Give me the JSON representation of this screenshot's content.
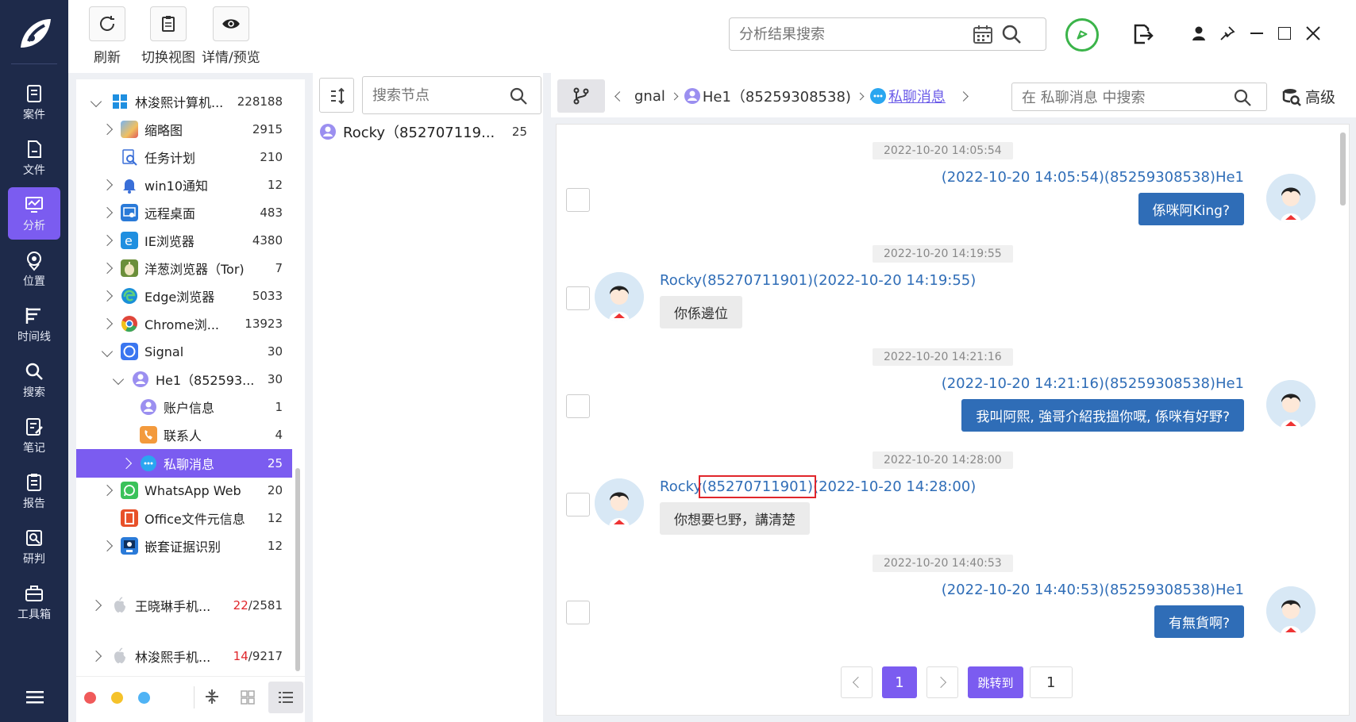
{
  "nav": {
    "items": [
      {
        "label": "案件",
        "icon": "case-icon"
      },
      {
        "label": "文件",
        "icon": "file-icon"
      },
      {
        "label": "分析",
        "icon": "analysis-icon"
      },
      {
        "label": "位置",
        "icon": "location-icon"
      },
      {
        "label": "时间线",
        "icon": "timeline-icon"
      },
      {
        "label": "搜索",
        "icon": "search-icon"
      },
      {
        "label": "笔记",
        "icon": "note-icon"
      },
      {
        "label": "报告",
        "icon": "report-icon"
      },
      {
        "label": "研判",
        "icon": "judge-icon"
      },
      {
        "label": "工具箱",
        "icon": "toolbox-icon"
      }
    ]
  },
  "toolbar": {
    "refresh": "刷新",
    "switch_view": "切换视图",
    "details": "详情/预览",
    "search_placeholder": "分析结果搜索"
  },
  "tree": {
    "root": {
      "label": "林浚熙计算机...",
      "count": "228188"
    },
    "items": [
      {
        "label": "缩略图",
        "count": "2915"
      },
      {
        "label": "任务计划",
        "count": "210"
      },
      {
        "label": "win10通知",
        "count": "12"
      },
      {
        "label": "远程桌面",
        "count": "483"
      },
      {
        "label": "IE浏览器",
        "count": "4380"
      },
      {
        "label": "洋葱浏览器（Tor)",
        "count": "7"
      },
      {
        "label": "Edge浏览器",
        "count": "5033"
      },
      {
        "label": "Chrome浏...",
        "count": "13923"
      },
      {
        "label": "Signal",
        "count": "30"
      },
      {
        "label": "He1（852593...",
        "count": "30"
      },
      {
        "label": "账户信息",
        "count": "1"
      },
      {
        "label": "联系人",
        "count": "4"
      },
      {
        "label": "私聊消息",
        "count": "25"
      },
      {
        "label": "WhatsApp Web",
        "count": "20"
      },
      {
        "label": "Office文件元信息",
        "count": "12"
      },
      {
        "label": "嵌套证据识别",
        "count": "12"
      }
    ],
    "device2": {
      "label": "王晓琳手机...",
      "count_red": "22",
      "count_total": "/2581"
    },
    "device3": {
      "label": "林浚熙手机...",
      "count_red": "14",
      "count_total": "/9217"
    }
  },
  "nodes": {
    "search_placeholder": "搜索节点",
    "items": [
      {
        "label": "Rocky（852707119...",
        "count": "25"
      }
    ]
  },
  "breadcrumb": {
    "part1": "gnal",
    "part2": "He1（85259308538)",
    "part3": "私聊消息",
    "search_placeholder": "在 私聊消息 中搜索",
    "advanced": "高级"
  },
  "messages": [
    {
      "time": "2022-10-20 14:05:54",
      "dir": "out",
      "sender": "(2022-10-20 14:05:54)(85259308538)He1",
      "text": "係咪阿King?"
    },
    {
      "time": "2022-10-20 14:19:55",
      "dir": "in",
      "sender": "Rocky(85270711901)(2022-10-20 14:19:55)",
      "text": "你係邊位"
    },
    {
      "time": "2022-10-20 14:21:16",
      "dir": "out",
      "sender": "(2022-10-20 14:21:16)(85259308538)He1",
      "text": "我叫阿熙, 強哥介紹我搵你嘅, 係咪有好野?"
    },
    {
      "time": "2022-10-20 14:28:00",
      "dir": "in",
      "sender_a": "Rocky",
      "sender_b": "(85270711901)",
      "sender_c": "(2022-10-20 14:28:00)",
      "text": "你想要乜野，講清楚"
    },
    {
      "time": "2022-10-20 14:40:53",
      "dir": "out",
      "sender": "(2022-10-20 14:40:53)(85259308538)He1",
      "text": "有無貨啊?"
    }
  ],
  "pager": {
    "current": "1",
    "jump_label": "跳转到",
    "jump_value": "1"
  },
  "colors": {
    "nav_bg": "#1e2a4a",
    "accent": "#7b5cf0",
    "bubble_out": "#2f6db7",
    "highlight_box": "#e0262b"
  }
}
